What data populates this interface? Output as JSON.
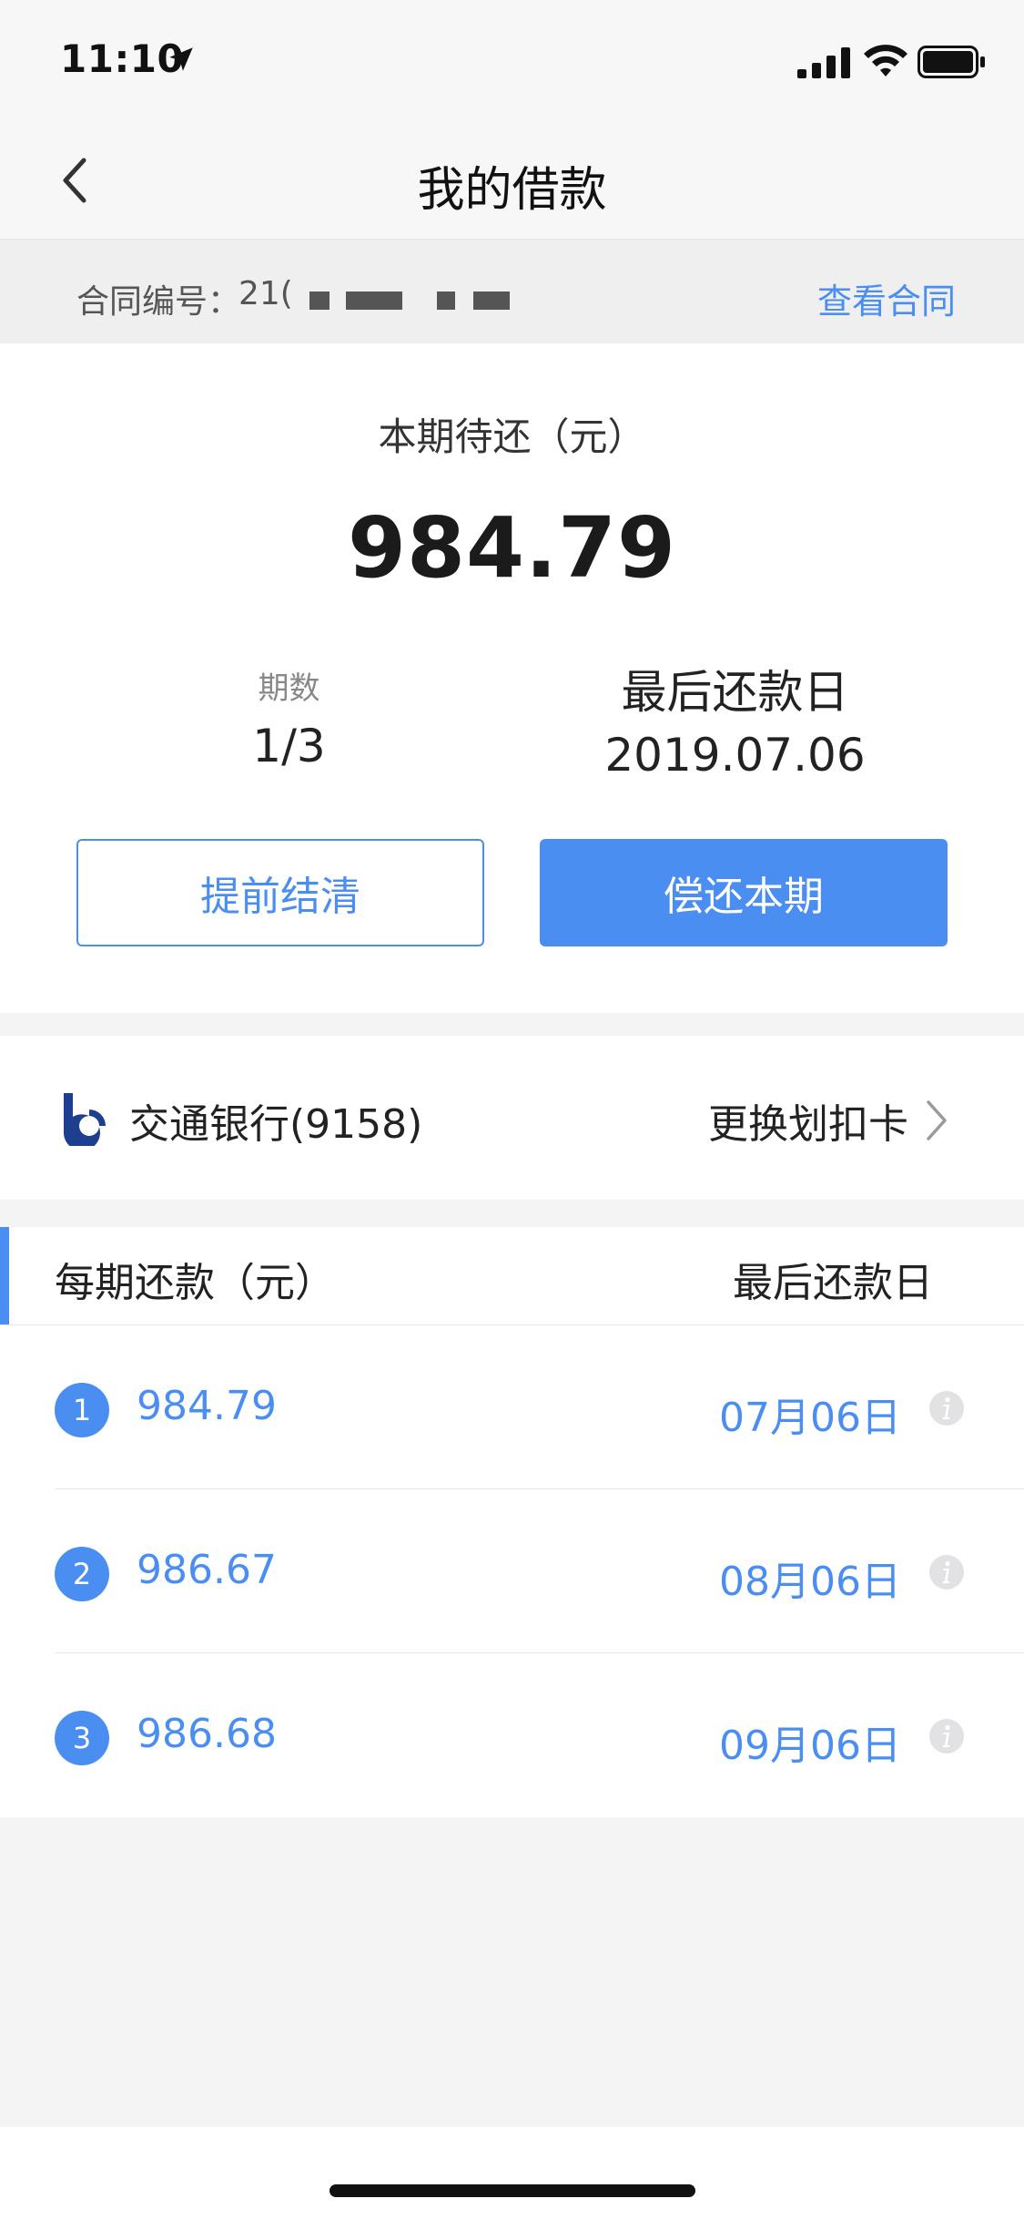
{
  "status_bar": {
    "time": "11:10",
    "icons": [
      "location-arrow-icon",
      "signal-icon",
      "wifi-icon",
      "battery-icon"
    ]
  },
  "nav": {
    "title": "我的借款",
    "back_icon": "chevron-left-icon"
  },
  "contract": {
    "label": "合同编号：",
    "number_visible_prefix": "21(",
    "link": "查看合同"
  },
  "current_due": {
    "label": "本期待还（元）",
    "amount": "984.79",
    "period_label": "期数",
    "period_value": "1/3",
    "lastday_label": "最后还款日",
    "lastday_value": "2019.07.06"
  },
  "actions": {
    "early_settle": "提前结清",
    "repay_current": "偿还本期"
  },
  "bank": {
    "name": "交通银行(9158)",
    "change_label": "更换划扣卡",
    "logo_icon": "bank-of-communications-logo"
  },
  "schedule": {
    "header_left": "每期还款（元）",
    "header_right": "最后还款日",
    "rows": [
      {
        "num": "1",
        "amount": "984.79",
        "date": "07月06日"
      },
      {
        "num": "2",
        "amount": "986.67",
        "date": "08月06日"
      },
      {
        "num": "3",
        "amount": "986.68",
        "date": "09月06日"
      }
    ]
  },
  "colors": {
    "accent": "#4b8ef2",
    "background": "#f4f4f5"
  }
}
